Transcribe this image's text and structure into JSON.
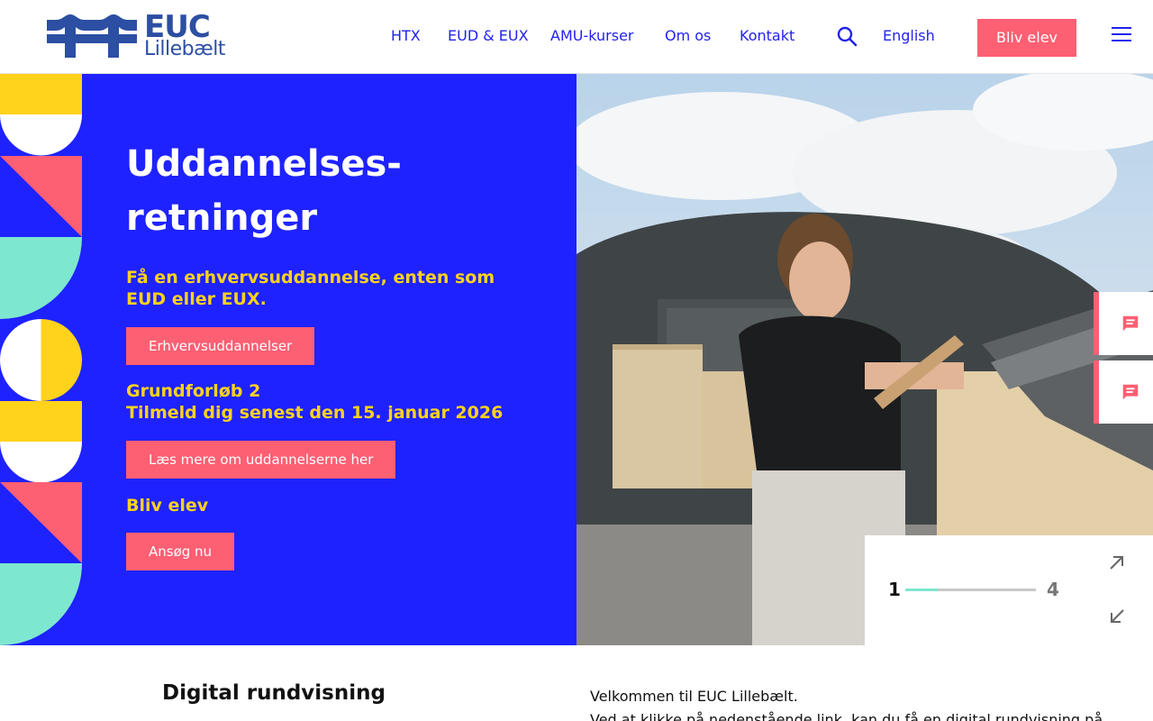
{
  "header": {
    "logo_title": "EUC",
    "logo_subtitle": "Lillebælt",
    "nav": [
      "HTX",
      "EUD & EUX",
      "AMU-kurser",
      "Om os",
      "Kontakt"
    ],
    "search_icon": "search-icon",
    "language_label": "English",
    "cta_label": "Bliv elev",
    "menu_icon": "hamburger-menu-icon"
  },
  "hero": {
    "title": "Uddannelses-retninger",
    "blocks": [
      {
        "text": "Få en erhvervsuddannelse, enten som EUD eller EUX.",
        "button": "Erhvervsuddannelser"
      },
      {
        "text": "Grundforløb 2\nTilmeld dig senest den 15. januar 2026",
        "button": "Læs mere om uddannelserne her"
      },
      {
        "text": "Bliv elev",
        "button": "Ansøg nu"
      }
    ],
    "slider": {
      "current": "1",
      "total": "4",
      "progress": 0.25
    },
    "side_buttons": [
      "chat-icon",
      "chat-icon"
    ]
  },
  "intro": {
    "heading": "Digital rundvisning",
    "welcome_line1": "Velkommen til EUC Lillebælt.",
    "welcome_line2": "Ved at klikke på nedenstående link, kan du få en digital rundvisning på"
  },
  "colors": {
    "primary_blue": "#1e22ff",
    "accent_pink": "#fd5f73",
    "accent_yellow": "#ffd21c",
    "accent_mint": "#7ee7cf",
    "logo_blue": "#2c4fa3"
  }
}
